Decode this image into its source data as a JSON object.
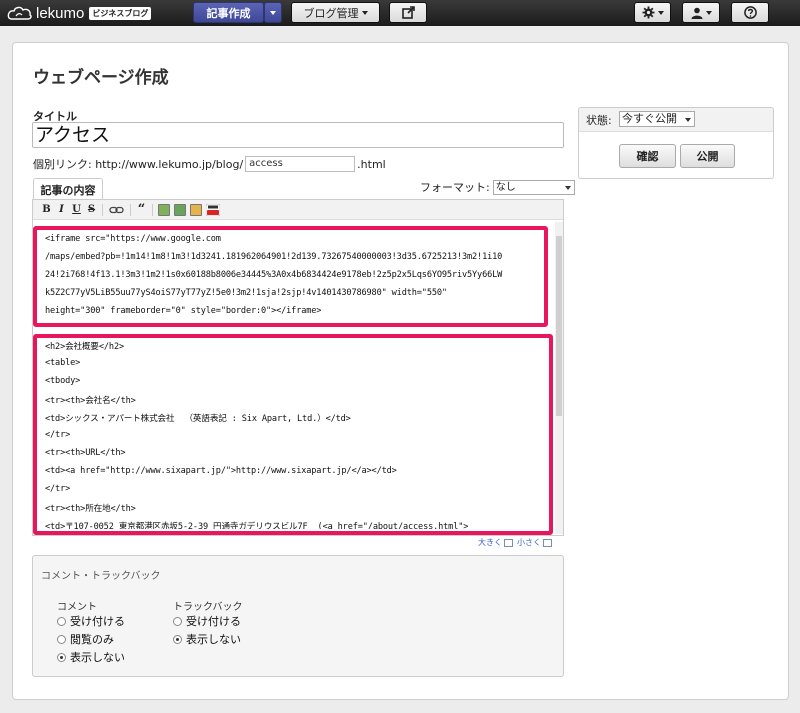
{
  "header": {
    "logo_text": "lekumo",
    "logo_badge": "ビジネスブログ",
    "compose_label": "記事作成",
    "blog_admin_label": "ブログ管理"
  },
  "page": {
    "title": "ウェブページ作成"
  },
  "form": {
    "title_label": "タイトル",
    "title_value": "アクセス",
    "permalink_label": "個別リンク: http://www.lekumo.jp/blog/",
    "basename_value": "access",
    "permalink_suffix": ".html",
    "body_tab": "記事の内容",
    "format_label": "フォーマット:",
    "format_value": "なし"
  },
  "toolbar": {
    "bold": "B",
    "italic": "I",
    "underline": "U",
    "strike": "S",
    "quote": "“"
  },
  "editor": {
    "lines": [
      "<iframe src=\"https://www.google.com",
      "/maps/embed?pb=!1m14!1m8!1m3!1d3241.181962064901!2d139.73267540000003!3d35.6725213!3m2!1i10",
      "24!2i768!4f13.1!3m3!1m2!1s0x60188b8006e34445%3A0x4b6834424e9178eb!2z5p2x5Lqs6YO95riv5Yy66LW",
      "k5Z2C77yV5LiB55uu77yS4oiS77yT77yZ!5e0!3m2!1sja!2sjp!4v1401430786980\" width=\"550\"",
      "height=\"300\" frameborder=\"0\" style=\"border:0\"></iframe>",
      "<h2>会社概要</h2>",
      "<table>",
      "<tbody>",
      "<tr><th>会社名</th>",
      "<td>シックス・アパート株式会社  （英語表記 : Six Apart, Ltd.）</td>",
      "</tr>",
      "<tr><th>URL</th>",
      "<td><a href=\"http://www.sixapart.jp/\">http://www.sixapart.jp/</a></td>",
      "</tr>",
      "<tr><th>所在地</th>",
      "<td>〒107-0052 東京都港区赤坂5-2-39 円通寺ガデリウスビル7F  (<a href=\"/about/access.html\">"
    ]
  },
  "resize": {
    "larger": "大きく",
    "smaller": "小さく"
  },
  "comments": {
    "section_title": "コメント・トラックバック",
    "comment_label": "コメント",
    "comment_options": [
      "受け付ける",
      "閲覧のみ",
      "表示しない"
    ],
    "comment_selected": "表示しない",
    "trackback_label": "トラックバック",
    "trackback_options": [
      "受け付ける",
      "表示しない"
    ],
    "trackback_selected": "表示しない"
  },
  "status": {
    "label": "状態:",
    "value": "今すぐ公開",
    "preview_button": "確認",
    "publish_button": "公開"
  }
}
